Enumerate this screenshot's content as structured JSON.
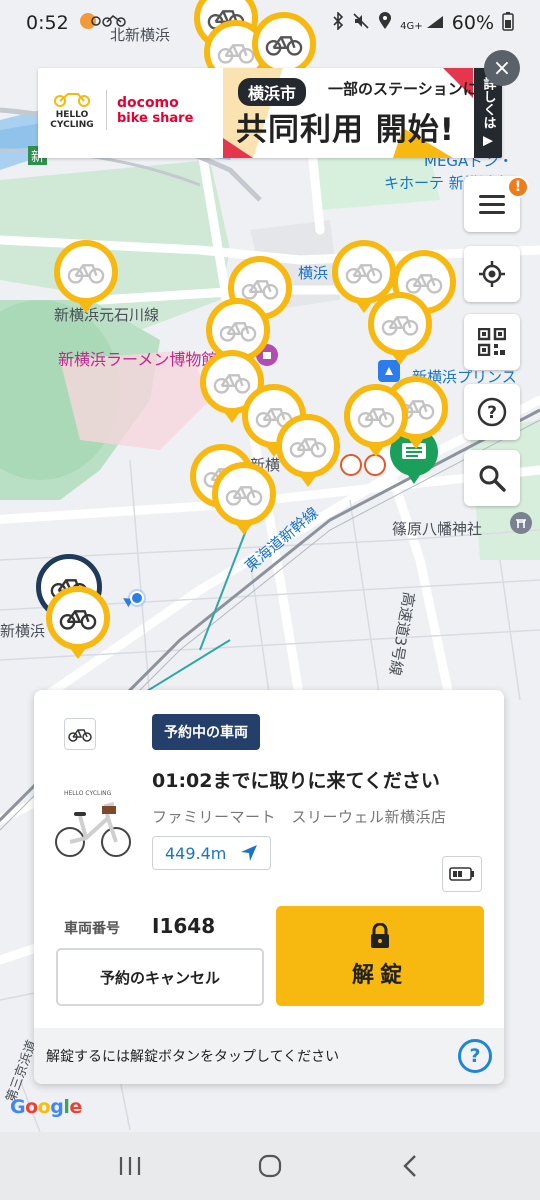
{
  "status_bar": {
    "time": "0:52",
    "battery": "60%",
    "network": "4G+"
  },
  "ad": {
    "brand_hello": "HELLO CYCLING",
    "brand_docomo": "docomo",
    "brand_bikeshare": "bike share",
    "city": "横浜市",
    "subtitle": "一部のステーションにて",
    "headline": "共同利用 開始!",
    "more": "詳しくは ▶",
    "close_icon": "×"
  },
  "map": {
    "labels": {
      "kita_shin_yokohama": "北新横浜",
      "mega_donki": "MEGAドン・",
      "donki_2": "キホーテ 新横浜店",
      "yokohama": "横浜",
      "shin_yokohama_line": "新横浜元石川線",
      "ramen_museum": "新横浜ラーメン博物館",
      "prince": "新横浜プリンス",
      "shin_yokohama_mid": "新横",
      "tokaido": "東海道新幹線",
      "shinohara": "篠原八幡神社",
      "highway": "高速道3号線",
      "shin_yokohama_left": "新横浜",
      "shin_label_top": "新",
      "side_road": "第三京浜道"
    },
    "google": "Google"
  },
  "sheet": {
    "status_chip": "予約中の車両",
    "deadline": "01:02までに取りに来てください",
    "station": "ファミリーマート　スリーウェル新横浜店",
    "distance": "449.4m",
    "thumb_brand": "HELLO CYCLING",
    "vehicle_label": "車両番号",
    "vehicle_number": "I1648",
    "cancel": "予約のキャンセル",
    "unlock": "解錠",
    "hint": "解錠するには解錠ボタンをタップしてください",
    "help": "?"
  },
  "fab": {
    "badge": "!",
    "help": "?"
  },
  "colors": {
    "accent_yellow": "#f7b80f",
    "chip_navy": "#24406a",
    "link_blue": "#1a73c8",
    "station_green": "#1aa05a"
  }
}
